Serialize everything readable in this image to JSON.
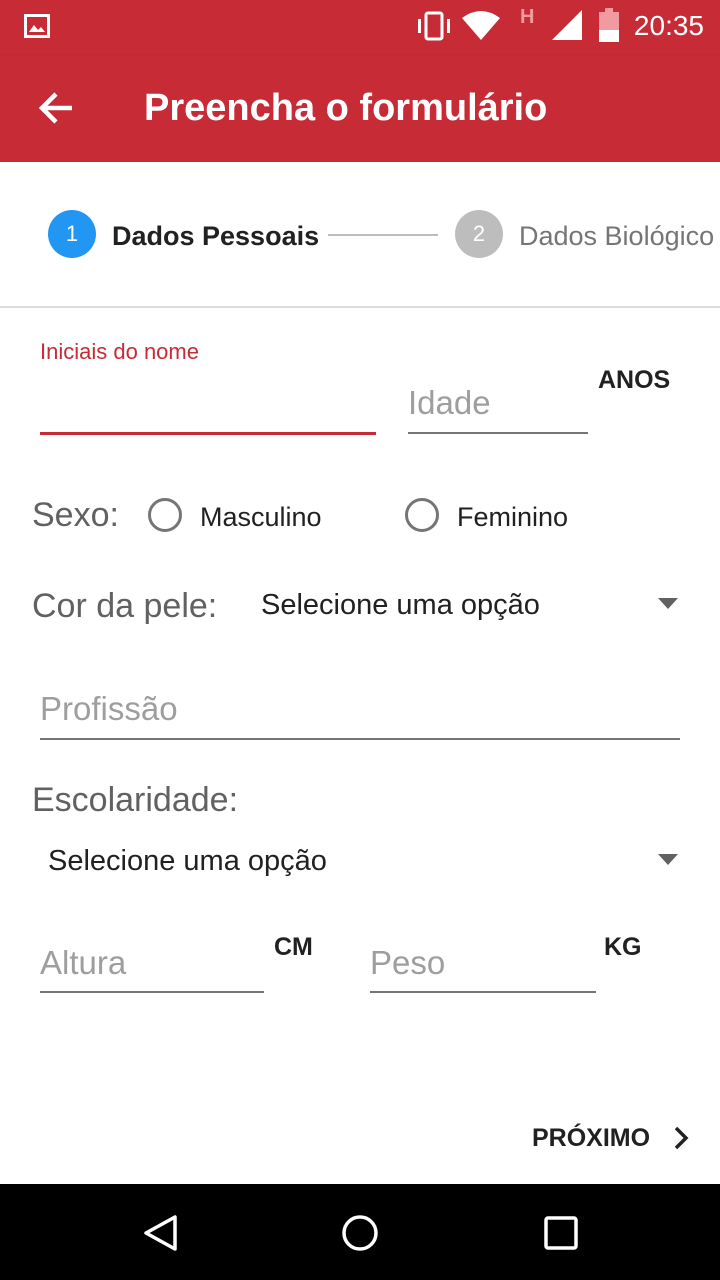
{
  "status_bar": {
    "time": "20:35",
    "network_label": "H",
    "icons": [
      "image-icon",
      "vibrate-icon",
      "wifi-icon",
      "signal-icon",
      "battery-icon"
    ]
  },
  "app_bar": {
    "title": "Preencha o formulário",
    "back_icon": "arrow-back-icon"
  },
  "stepper": {
    "steps": [
      {
        "number": "1",
        "label": "Dados Pessoais",
        "active": true
      },
      {
        "number": "2",
        "label": "Dados Biológico",
        "active": false
      }
    ]
  },
  "form": {
    "initials": {
      "label": "Iniciais do nome",
      "value": ""
    },
    "age": {
      "placeholder": "Idade",
      "unit": "ANOS"
    },
    "sex": {
      "label": "Sexo:",
      "options": [
        "Masculino",
        "Feminino"
      ]
    },
    "skin_color": {
      "label": "Cor da pele:",
      "selected": "Selecione uma opção"
    },
    "profession": {
      "placeholder": "Profissão"
    },
    "education": {
      "label": "Escolaridade:",
      "selected": "Selecione uma opção"
    },
    "height": {
      "placeholder": "Altura",
      "unit": "CM"
    },
    "weight": {
      "placeholder": "Peso",
      "unit": "KG"
    }
  },
  "actions": {
    "next_label": "PRÓXIMO"
  },
  "colors": {
    "primary": "#c62b36",
    "step_active": "#2196f3",
    "step_inactive": "#bdbdbd"
  },
  "nav_bar": {
    "icons": [
      "back-triangle-icon",
      "home-circle-icon",
      "recents-square-icon"
    ]
  }
}
